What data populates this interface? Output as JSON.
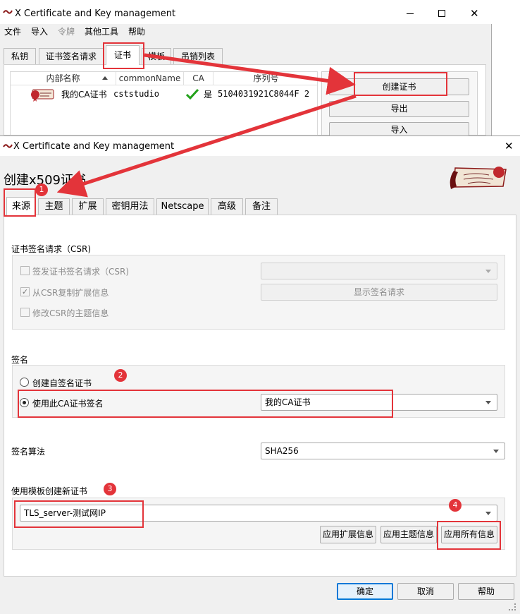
{
  "bg_window": {
    "title": "X Certificate and Key management",
    "menu": [
      "文件",
      "导入",
      "令牌",
      "其他工具",
      "帮助"
    ],
    "tabs": [
      "私钥",
      "证书签名请求",
      "证书",
      "模板",
      "吊销列表"
    ],
    "columns": [
      "内部名称",
      "commonName",
      "CA",
      "序列号"
    ],
    "row": {
      "name": "我的CA证书",
      "common_name": "cststudio",
      "ca": "是",
      "serial": "5104031921C8044F 2"
    },
    "buttons": {
      "create": "创建证书",
      "export": "导出",
      "import": "导入"
    }
  },
  "dialog": {
    "title": "X Certificate and Key management",
    "heading": "创建x509证书",
    "tabs": [
      "来源",
      "主题",
      "扩展",
      "密钥用法",
      "Netscape",
      "高级",
      "备注"
    ],
    "csr": {
      "section_label": "证书签名请求（CSR)",
      "sign_csr": "签发证书签名请求（CSR)",
      "copy_ext": "从CSR复制扩展信息",
      "modify_subject": "修改CSR的主题信息",
      "show_request": "显示签名请求",
      "csr_select": ""
    },
    "signing": {
      "section_label": "签名",
      "self_signed": "创建自签名证书",
      "use_ca": "使用此CA证书签名",
      "ca_select": "我的CA证书"
    },
    "algorithm": {
      "label": "签名算法",
      "value": "SHA256"
    },
    "template": {
      "section_label": "使用模板创建新证书",
      "value": "TLS_server-测试网IP",
      "apply_ext": "应用扩展信息",
      "apply_subject": "应用主题信息",
      "apply_all": "应用所有信息"
    },
    "footer": {
      "ok": "确定",
      "cancel": "取消",
      "help": "帮助"
    }
  },
  "badges": [
    "1",
    "2",
    "3",
    "4"
  ],
  "colors": {
    "annotation_red": "#e3343a",
    "ok_border": "#0078d7",
    "check_green": "#22a11a"
  },
  "icons": [
    "app-icon",
    "minimize-icon",
    "maximize-icon",
    "close-icon",
    "certificate-icon",
    "ca-check-icon",
    "sort-arrow-icon",
    "chevron-down-icon"
  ]
}
